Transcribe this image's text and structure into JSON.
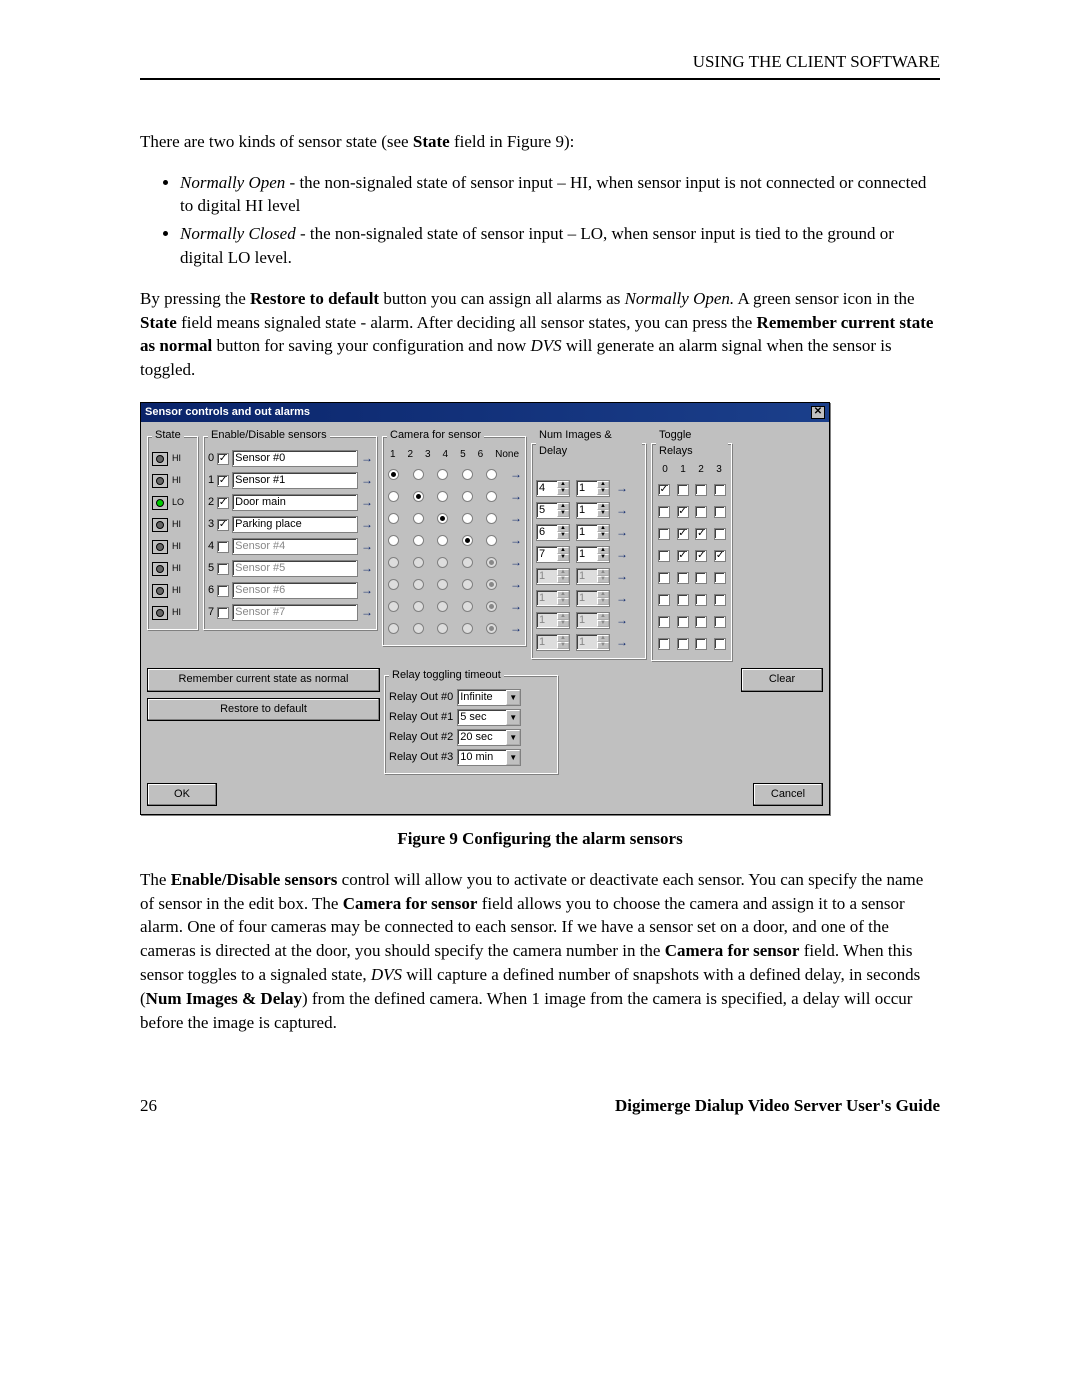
{
  "header": {
    "section_title": "USING THE CLIENT SOFTWARE"
  },
  "intro": {
    "p1_a": "There are two kinds of sensor state (see ",
    "p1_b": "State",
    "p1_c": " field in Figure 9):",
    "bullets": [
      {
        "term": "Normally Open",
        "rest": " - the non-signaled state of sensor input – HI, when sensor input is not connected or connected to digital HI level"
      },
      {
        "term": "Normally Closed",
        "rest": " - the non-signaled state of sensor input – LO, when sensor input is tied to the ground or digital LO level."
      }
    ],
    "p2_a": "By pressing the ",
    "p2_b": "Restore to default",
    "p2_c": " button you can assign all alarms as ",
    "p2_d": "Normally Open.",
    "p2_e": " A green sensor icon in the ",
    "p2_f": "State",
    "p2_g": " field means signaled state - alarm. After deciding all sensor states, you can press the ",
    "p2_h": "Remember current state as normal",
    "p2_i": " button for saving your configuration and now ",
    "p2_j": "DVS",
    "p2_k": " will generate an alarm signal when the sensor is toggled."
  },
  "dialog": {
    "title": "Sensor controls and out alarms",
    "groups": {
      "state": "State",
      "enable": "Enable/Disable sensors",
      "camera": "Camera for sensor",
      "numdelay": "Num Images & Delay",
      "toggle": "Toggle Relays"
    },
    "cam_headers": [
      "1",
      "2",
      "3",
      "4",
      "5",
      "6",
      "None"
    ],
    "toggle_headers": [
      "0",
      "1",
      "2",
      "3"
    ],
    "sensors": [
      {
        "idx": "0",
        "state": "HI",
        "green": false,
        "enabled": true,
        "name": "Sensor #0",
        "cam": 0,
        "num": "4",
        "delay": "1",
        "toggles": [
          true,
          false,
          false,
          false
        ]
      },
      {
        "idx": "1",
        "state": "HI",
        "green": false,
        "enabled": true,
        "name": "Sensor #1",
        "cam": 1,
        "num": "5",
        "delay": "1",
        "toggles": [
          false,
          true,
          false,
          false
        ]
      },
      {
        "idx": "2",
        "state": "LO",
        "green": true,
        "enabled": true,
        "name": "Door main",
        "cam": 2,
        "num": "6",
        "delay": "1",
        "toggles": [
          false,
          true,
          true,
          false
        ]
      },
      {
        "idx": "3",
        "state": "HI",
        "green": false,
        "enabled": true,
        "name": "Parking place",
        "cam": 3,
        "num": "7",
        "delay": "1",
        "toggles": [
          false,
          true,
          true,
          true
        ]
      },
      {
        "idx": "4",
        "state": "HI",
        "green": false,
        "enabled": false,
        "name": "Sensor #4",
        "cam": 6,
        "num": "1",
        "delay": "1",
        "toggles": [
          false,
          false,
          false,
          false
        ]
      },
      {
        "idx": "5",
        "state": "HI",
        "green": false,
        "enabled": false,
        "name": "Sensor #5",
        "cam": 6,
        "num": "1",
        "delay": "1",
        "toggles": [
          false,
          false,
          false,
          false
        ]
      },
      {
        "idx": "6",
        "state": "HI",
        "green": false,
        "enabled": false,
        "name": "Sensor #6",
        "cam": 6,
        "num": "1",
        "delay": "1",
        "toggles": [
          false,
          false,
          false,
          false
        ]
      },
      {
        "idx": "7",
        "state": "HI",
        "green": false,
        "enabled": false,
        "name": "Sensor #7",
        "cam": 6,
        "num": "1",
        "delay": "1",
        "toggles": [
          false,
          false,
          false,
          false
        ]
      }
    ],
    "buttons": {
      "remember": "Remember current state as normal",
      "restore": "Restore to default",
      "clear": "Clear",
      "ok": "OK",
      "cancel": "Cancel"
    },
    "relay_group": "Relay toggling timeout",
    "relays": [
      {
        "label": "Relay Out #0",
        "value": "Infinite"
      },
      {
        "label": "Relay Out #1",
        "value": "5 sec"
      },
      {
        "label": "Relay Out #2",
        "value": "20 sec"
      },
      {
        "label": "Relay Out #3",
        "value": "10 min"
      }
    ]
  },
  "figure_caption": "Figure 9 Configuring the alarm sensors",
  "post": {
    "a": "The ",
    "b": "Enable/Disable sensors",
    "c": " control will allow you to activate or deactivate each sensor. You can specify the name of sensor in the edit box. The ",
    "d": "Camera for sensor",
    "e": " field allows you to choose the camera and assign it to a sensor alarm.  One of four cameras may be connected to each sensor. If we have a sensor set on a door, and one of the cameras is directed at the door, you should specify the camera number in the ",
    "f": "Camera for sensor",
    "g": " field. When this sensor toggles to a signaled state, ",
    "h": "DVS",
    "i": " will capture a defined number of snapshots with a defined delay, in seconds (",
    "j": "Num Images & Delay",
    "k": ") from the defined camera. When 1 image from the camera is specified, a delay will occur before the image is captured."
  },
  "footer": {
    "page": "26",
    "guide": "Digimerge Dialup Video Server User's Guide"
  }
}
